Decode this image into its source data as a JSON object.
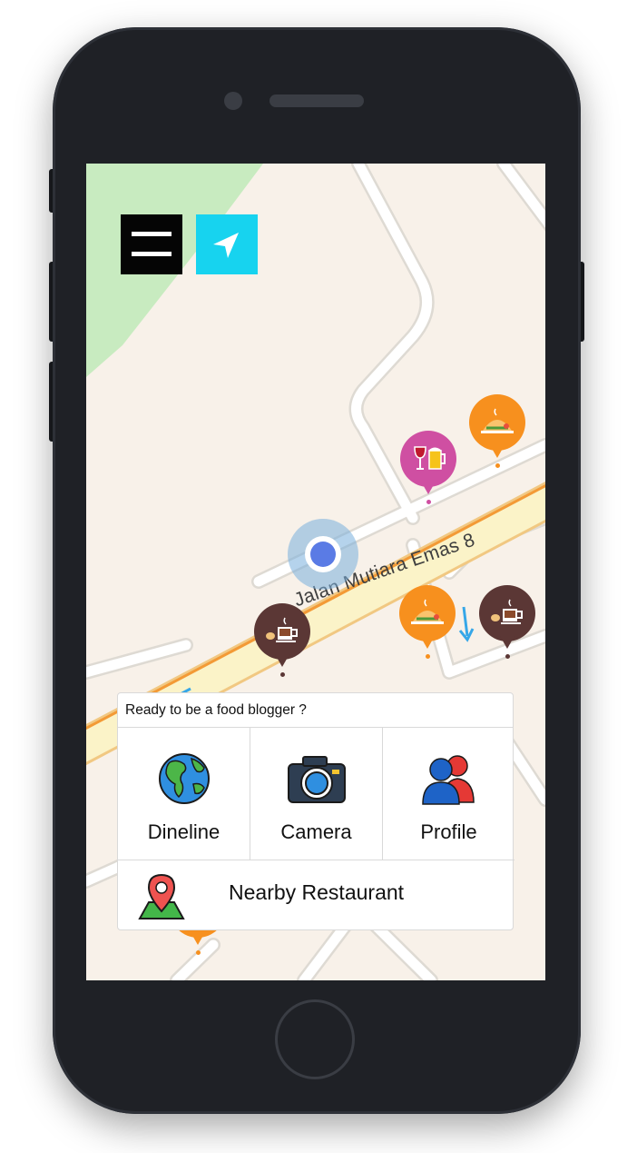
{
  "map": {
    "road_name": "Jalan Mutiara Emas 8"
  },
  "top_bar": {
    "menu_icon": "hamburger-menu-icon",
    "locate_icon": "navigation-arrow-icon",
    "locate_color": "#17d3ef"
  },
  "markers": [
    {
      "type": "restaurant",
      "icon": "food-dish-icon",
      "color": "#f7901e"
    },
    {
      "type": "bar",
      "icon": "wine-beer-icon",
      "color": "#cf4fa2"
    },
    {
      "type": "cafe",
      "icon": "coffee-cup-icon",
      "color": "#5b3735"
    },
    {
      "type": "restaurant",
      "icon": "food-dish-icon",
      "color": "#f7901e"
    },
    {
      "type": "cafe",
      "icon": "coffee-cup-icon",
      "color": "#5b3735"
    },
    {
      "type": "restaurant",
      "icon": "food-dish-icon",
      "color": "#f7901e"
    }
  ],
  "panel": {
    "title": "Ready to be a food blogger ?",
    "actions": [
      {
        "label": "Dineline",
        "icon": "globe-icon"
      },
      {
        "label": "Camera",
        "icon": "camera-icon"
      },
      {
        "label": "Profile",
        "icon": "users-icon"
      }
    ],
    "nearby": {
      "label": "Nearby Restaurant",
      "icon": "map-pin-icon"
    }
  }
}
